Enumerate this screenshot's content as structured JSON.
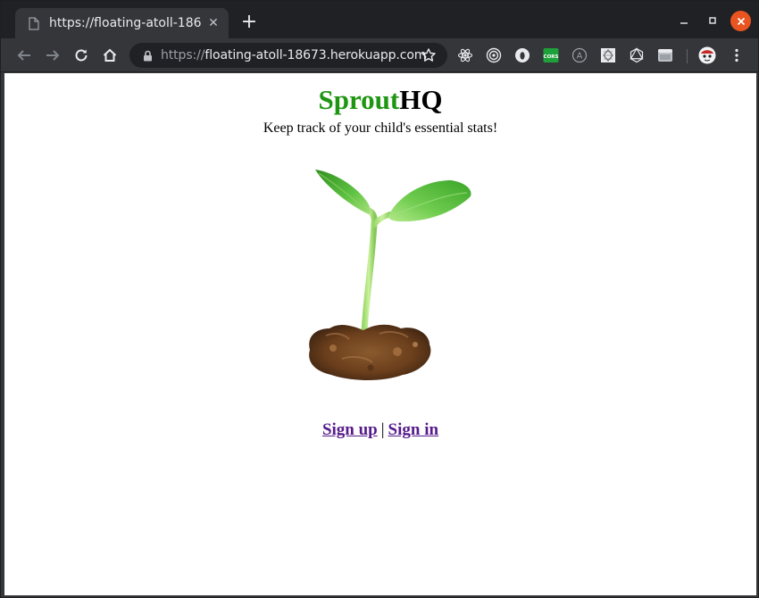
{
  "browser": {
    "tab_title": "https://floating-atoll-186",
    "tab_close": "✕",
    "new_tab": "+",
    "url_scheme": "https://",
    "url_rest": "floating-atoll-18673.herokuapp.com",
    "extensions": [
      "react-icon",
      "target-icon",
      "ghostery-icon",
      "cors-icon",
      "a-icon",
      "puzzle-icon",
      "graphql-icon",
      "window-icon"
    ],
    "cors_label": "CORS",
    "a_label": "A"
  },
  "page": {
    "brand_part1": "Sprout",
    "brand_part2": "HQ",
    "tagline": "Keep track of your child's essential stats!",
    "signup_label": "Sign up",
    "separator": "|",
    "signin_label": "Sign in"
  },
  "colors": {
    "brand_green": "#1e9612",
    "link_visited": "#551a8b",
    "close_button": "#e95420"
  }
}
